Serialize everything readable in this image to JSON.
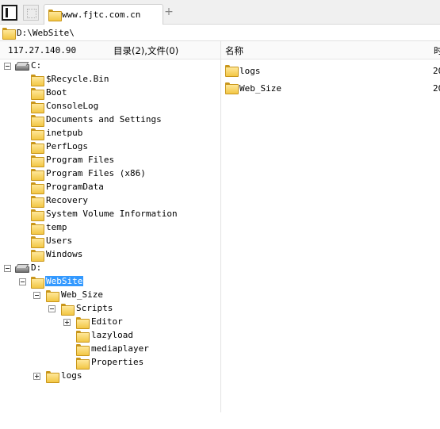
{
  "tab": {
    "title": "www.fjtc.com.cn",
    "add_symbol": "+"
  },
  "address": {
    "path": "D:\\WebSite\\"
  },
  "info": {
    "ip": "117.27.140.90",
    "summary": "目录(2),文件(0)"
  },
  "list": {
    "headers": {
      "name": "名称",
      "truncated": "时"
    },
    "items": [
      {
        "name": "logs",
        "trail": "20"
      },
      {
        "name": "Web_Size",
        "trail": "20"
      }
    ]
  },
  "tree": {
    "c_drive": "C:",
    "c_children": [
      "$Recycle.Bin",
      "Boot",
      "ConsoleLog",
      "Documents and Settings",
      "inetpub",
      "PerfLogs",
      "Program Files",
      "Program Files (x86)",
      "ProgramData",
      "Recovery",
      "System Volume Information",
      "temp",
      "Users",
      "Windows"
    ],
    "d_drive": "D:",
    "website": "WebSite",
    "web_size": "Web_Size",
    "scripts": "Scripts",
    "scripts_children": [
      "Editor",
      "lazyload",
      "mediaplayer",
      "Properties"
    ],
    "logs": "logs"
  },
  "colors": {
    "selection": "#3399ff",
    "folder": "#f2c644"
  }
}
